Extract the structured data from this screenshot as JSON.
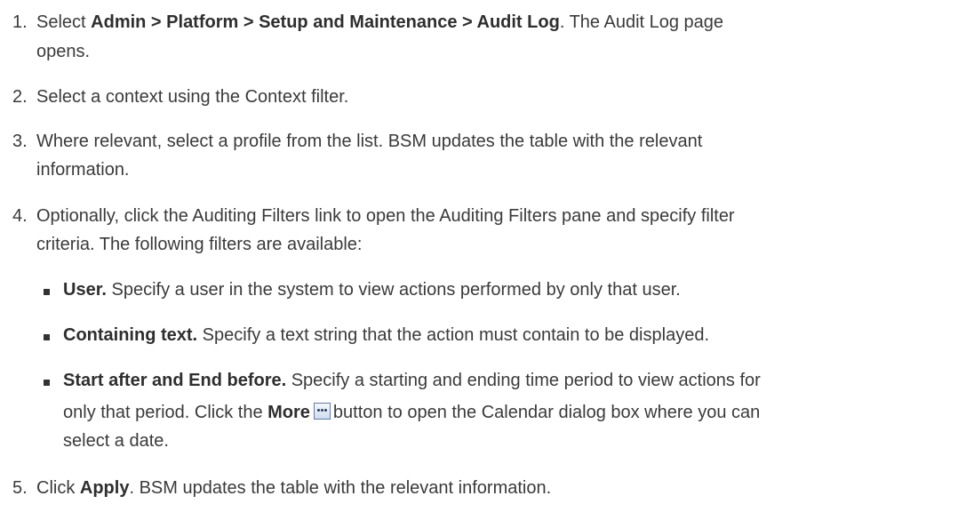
{
  "steps": [
    {
      "number": "1.",
      "parts": [
        "Select ",
        "Admin > Platform > Setup and Maintenance > Audit Log",
        ". The Audit Log page",
        "opens."
      ]
    },
    {
      "number": "2.",
      "text": "Select a context using the Context filter."
    },
    {
      "number": "3.",
      "lines": [
        "Where relevant, select a profile from the list. BSM updates the table with the relevant",
        "information."
      ]
    },
    {
      "number": "4.",
      "lines": [
        "Optionally, click the Auditing Filters link to open the Auditing Filters pane and specify filter",
        "criteria. The following filters are available:"
      ],
      "filters": [
        {
          "term": "User.",
          "desc": "Specify a user in the system to view actions performed by only that user."
        },
        {
          "term": "Containing text.",
          "desc": "Specify a text string that the action must contain to be displayed."
        },
        {
          "term": "Start after and End before.",
          "desc": "Specify a starting and ending time period to view actions for",
          "line2_before": "only that period. Click the ",
          "more_label": "More",
          "more_icon": "ellipsis-button-icon",
          "line2_after": "button to open the Calendar dialog box where you can",
          "line3": "select a date."
        }
      ]
    },
    {
      "number": "5.",
      "parts": [
        "Click ",
        "Apply",
        ". BSM updates the table with the relevant information."
      ]
    }
  ]
}
